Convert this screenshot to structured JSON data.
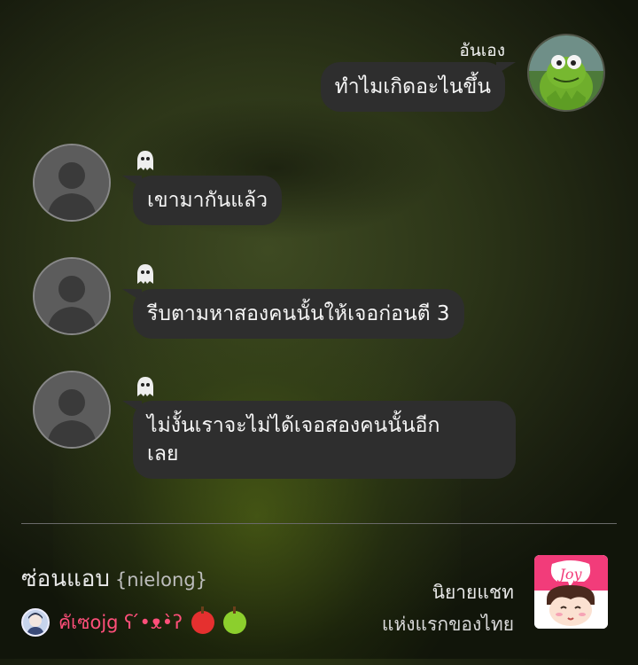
{
  "chat": {
    "self_name": "อันเอง",
    "messages": [
      {
        "side": "right",
        "text": "ทำไมเกิดอะไนขึ้น"
      },
      {
        "side": "left",
        "icon": "ghost-icon",
        "text": "เขามากันแล้ว"
      },
      {
        "side": "left",
        "icon": "ghost-icon",
        "text": "รีบตามหาสองคนนั้นให้เจอก่อนตี 3"
      },
      {
        "side": "left",
        "icon": "ghost-icon",
        "text_line1": "ไม่งั้นเราจะไม่ได้เจอสองคนนั้นอีก",
        "text_line2": "เลย"
      }
    ]
  },
  "footer": {
    "story_title": "ซ่อนแอบ",
    "story_author": "{nielong}",
    "writer_name": "คัเซojg ʕ ́•ᴥ•̀ʔ",
    "writer_badges": [
      "red-apple-icon",
      "green-apple-icon"
    ],
    "tagline_line1": "นิยายแชท",
    "tagline_line2": "แห่งแรกของไทย",
    "logo_text": "Joy"
  },
  "colors": {
    "bubble": "#2e2e2e",
    "writer_name": "#ff4f7a",
    "logo_pink": "#f23c7a"
  }
}
